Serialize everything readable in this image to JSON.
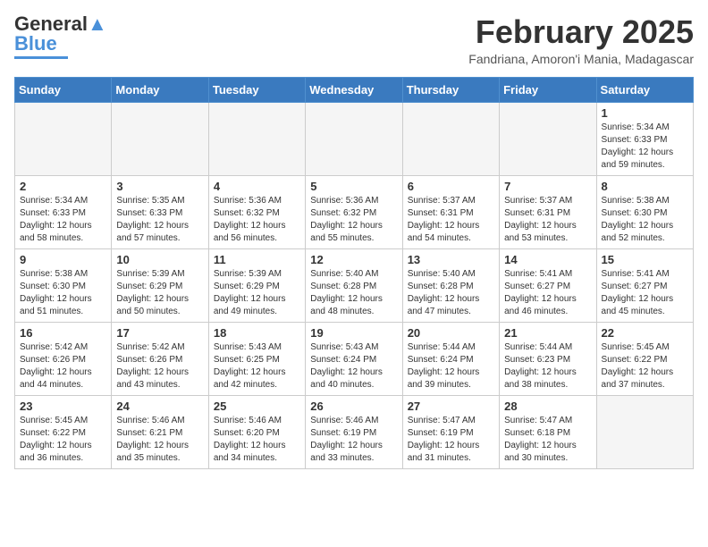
{
  "logo": {
    "text_general": "General",
    "text_blue": "Blue"
  },
  "title": {
    "month_year": "February 2025",
    "location": "Fandriana, Amoron'i Mania, Madagascar"
  },
  "weekdays": [
    "Sunday",
    "Monday",
    "Tuesday",
    "Wednesday",
    "Thursday",
    "Friday",
    "Saturday"
  ],
  "weeks": [
    [
      {
        "day": "",
        "info": ""
      },
      {
        "day": "",
        "info": ""
      },
      {
        "day": "",
        "info": ""
      },
      {
        "day": "",
        "info": ""
      },
      {
        "day": "",
        "info": ""
      },
      {
        "day": "",
        "info": ""
      },
      {
        "day": "1",
        "info": "Sunrise: 5:34 AM\nSunset: 6:33 PM\nDaylight: 12 hours and 59 minutes."
      }
    ],
    [
      {
        "day": "2",
        "info": "Sunrise: 5:34 AM\nSunset: 6:33 PM\nDaylight: 12 hours and 58 minutes."
      },
      {
        "day": "3",
        "info": "Sunrise: 5:35 AM\nSunset: 6:33 PM\nDaylight: 12 hours and 57 minutes."
      },
      {
        "day": "4",
        "info": "Sunrise: 5:36 AM\nSunset: 6:32 PM\nDaylight: 12 hours and 56 minutes."
      },
      {
        "day": "5",
        "info": "Sunrise: 5:36 AM\nSunset: 6:32 PM\nDaylight: 12 hours and 55 minutes."
      },
      {
        "day": "6",
        "info": "Sunrise: 5:37 AM\nSunset: 6:31 PM\nDaylight: 12 hours and 54 minutes."
      },
      {
        "day": "7",
        "info": "Sunrise: 5:37 AM\nSunset: 6:31 PM\nDaylight: 12 hours and 53 minutes."
      },
      {
        "day": "8",
        "info": "Sunrise: 5:38 AM\nSunset: 6:30 PM\nDaylight: 12 hours and 52 minutes."
      }
    ],
    [
      {
        "day": "9",
        "info": "Sunrise: 5:38 AM\nSunset: 6:30 PM\nDaylight: 12 hours and 51 minutes."
      },
      {
        "day": "10",
        "info": "Sunrise: 5:39 AM\nSunset: 6:29 PM\nDaylight: 12 hours and 50 minutes."
      },
      {
        "day": "11",
        "info": "Sunrise: 5:39 AM\nSunset: 6:29 PM\nDaylight: 12 hours and 49 minutes."
      },
      {
        "day": "12",
        "info": "Sunrise: 5:40 AM\nSunset: 6:28 PM\nDaylight: 12 hours and 48 minutes."
      },
      {
        "day": "13",
        "info": "Sunrise: 5:40 AM\nSunset: 6:28 PM\nDaylight: 12 hours and 47 minutes."
      },
      {
        "day": "14",
        "info": "Sunrise: 5:41 AM\nSunset: 6:27 PM\nDaylight: 12 hours and 46 minutes."
      },
      {
        "day": "15",
        "info": "Sunrise: 5:41 AM\nSunset: 6:27 PM\nDaylight: 12 hours and 45 minutes."
      }
    ],
    [
      {
        "day": "16",
        "info": "Sunrise: 5:42 AM\nSunset: 6:26 PM\nDaylight: 12 hours and 44 minutes."
      },
      {
        "day": "17",
        "info": "Sunrise: 5:42 AM\nSunset: 6:26 PM\nDaylight: 12 hours and 43 minutes."
      },
      {
        "day": "18",
        "info": "Sunrise: 5:43 AM\nSunset: 6:25 PM\nDaylight: 12 hours and 42 minutes."
      },
      {
        "day": "19",
        "info": "Sunrise: 5:43 AM\nSunset: 6:24 PM\nDaylight: 12 hours and 40 minutes."
      },
      {
        "day": "20",
        "info": "Sunrise: 5:44 AM\nSunset: 6:24 PM\nDaylight: 12 hours and 39 minutes."
      },
      {
        "day": "21",
        "info": "Sunrise: 5:44 AM\nSunset: 6:23 PM\nDaylight: 12 hours and 38 minutes."
      },
      {
        "day": "22",
        "info": "Sunrise: 5:45 AM\nSunset: 6:22 PM\nDaylight: 12 hours and 37 minutes."
      }
    ],
    [
      {
        "day": "23",
        "info": "Sunrise: 5:45 AM\nSunset: 6:22 PM\nDaylight: 12 hours and 36 minutes."
      },
      {
        "day": "24",
        "info": "Sunrise: 5:46 AM\nSunset: 6:21 PM\nDaylight: 12 hours and 35 minutes."
      },
      {
        "day": "25",
        "info": "Sunrise: 5:46 AM\nSunset: 6:20 PM\nDaylight: 12 hours and 34 minutes."
      },
      {
        "day": "26",
        "info": "Sunrise: 5:46 AM\nSunset: 6:19 PM\nDaylight: 12 hours and 33 minutes."
      },
      {
        "day": "27",
        "info": "Sunrise: 5:47 AM\nSunset: 6:19 PM\nDaylight: 12 hours and 31 minutes."
      },
      {
        "day": "28",
        "info": "Sunrise: 5:47 AM\nSunset: 6:18 PM\nDaylight: 12 hours and 30 minutes."
      },
      {
        "day": "",
        "info": ""
      }
    ]
  ]
}
